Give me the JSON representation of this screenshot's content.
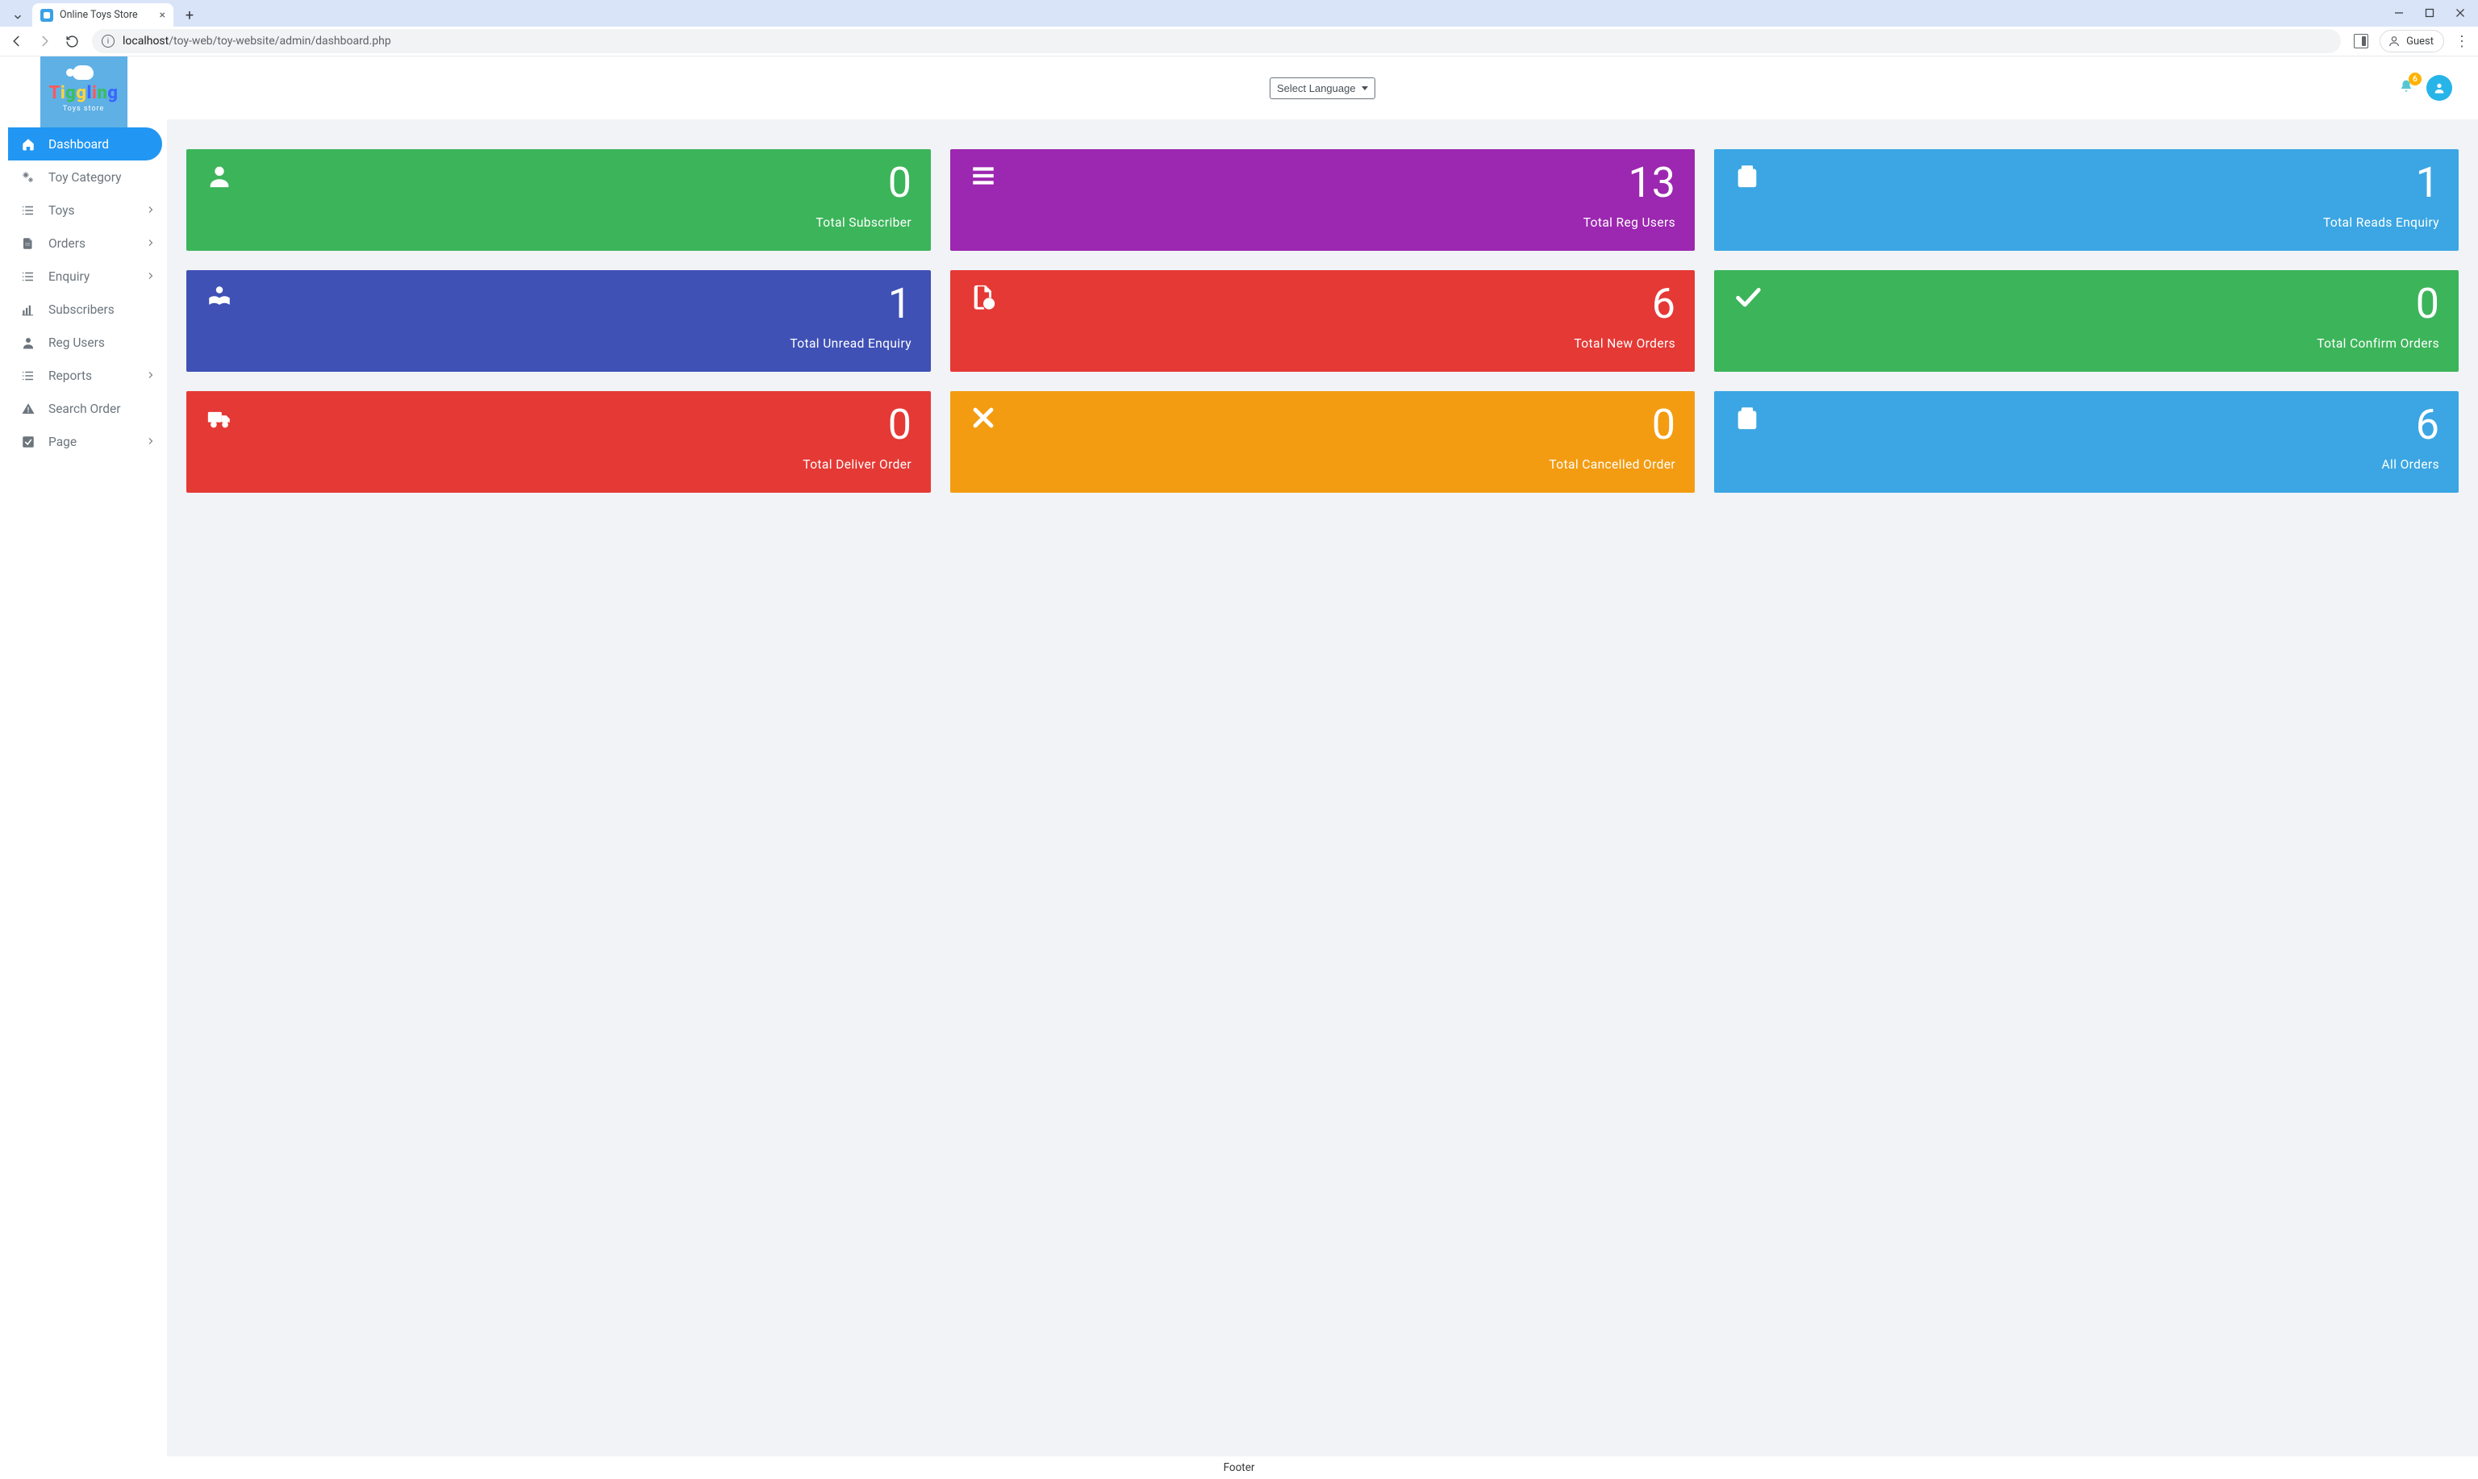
{
  "browser": {
    "tab_title": "Online Toys Store",
    "url_host": "localhost",
    "url_path": "/toy-web/toy-website/admin/dashboard.php",
    "guest_label": "Guest"
  },
  "header": {
    "logo_text": "Tiggling",
    "logo_sub": "Toys store",
    "language_placeholder": "Select Language",
    "notification_count": "6"
  },
  "sidebar": {
    "items": [
      {
        "label": "Dashboard",
        "icon": "home-icon",
        "expandable": false,
        "active": true
      },
      {
        "label": "Toy Category",
        "icon": "gears-icon",
        "expandable": false,
        "active": false
      },
      {
        "label": "Toys",
        "icon": "list-icon",
        "expandable": true,
        "active": false
      },
      {
        "label": "Orders",
        "icon": "file-icon",
        "expandable": true,
        "active": false
      },
      {
        "label": "Enquiry",
        "icon": "list-icon",
        "expandable": true,
        "active": false
      },
      {
        "label": "Subscribers",
        "icon": "bar-chart-icon",
        "expandable": false,
        "active": false
      },
      {
        "label": "Reg Users",
        "icon": "user-icon",
        "expandable": false,
        "active": false
      },
      {
        "label": "Reports",
        "icon": "list-icon",
        "expandable": true,
        "active": false
      },
      {
        "label": "Search Order",
        "icon": "warning-icon",
        "expandable": false,
        "active": false
      },
      {
        "label": "Page",
        "icon": "checkbox-icon",
        "expandable": true,
        "active": false
      }
    ]
  },
  "cards": [
    {
      "value": "0",
      "label": "Total Subscriber",
      "color": "green",
      "icon": "user-icon"
    },
    {
      "value": "13",
      "label": "Total Reg Users",
      "color": "purple",
      "icon": "menu-icon"
    },
    {
      "value": "1",
      "label": "Total Reads Enquiry",
      "color": "blue",
      "icon": "clipboard-question-icon"
    },
    {
      "value": "1",
      "label": "Total Unread Enquiry",
      "color": "indigo",
      "icon": "reader-icon"
    },
    {
      "value": "6",
      "label": "Total New Orders",
      "color": "red",
      "icon": "file-plus-icon"
    },
    {
      "value": "0",
      "label": "Total Confirm Orders",
      "color": "dgreen",
      "icon": "check-icon"
    },
    {
      "value": "0",
      "label": "Total Deliver Order",
      "color": "red",
      "icon": "truck-icon"
    },
    {
      "value": "0",
      "label": "Total Cancelled Order",
      "color": "orange",
      "icon": "x-icon"
    },
    {
      "value": "6",
      "label": "All Orders",
      "color": "blue",
      "icon": "clipboard-check-icon"
    }
  ],
  "footer": {
    "text": "Footer"
  }
}
